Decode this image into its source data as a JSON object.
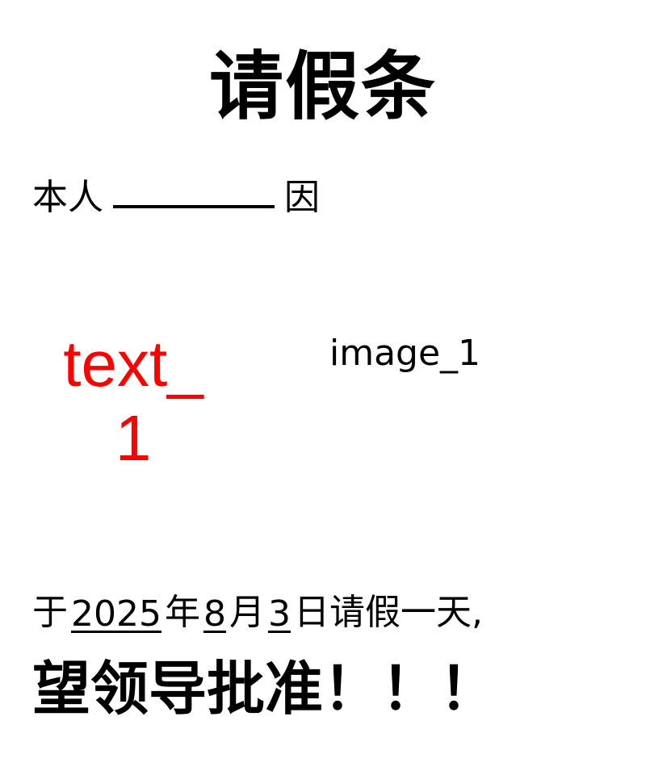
{
  "document": {
    "title": "请假条",
    "intro_prefix": "本人",
    "intro_suffix": "因",
    "reason_text": "text_1",
    "image_label": "image_1",
    "date_prefix": "于",
    "year": "2025",
    "year_unit": "年",
    "month": "8",
    "month_unit": "月",
    "day": "3",
    "day_suffix": "日请假一天,",
    "closing": "望领导批准！！！"
  },
  "colors": {
    "reason_text": "#ff0000",
    "body_text": "#000000",
    "background": "#ffffff"
  }
}
